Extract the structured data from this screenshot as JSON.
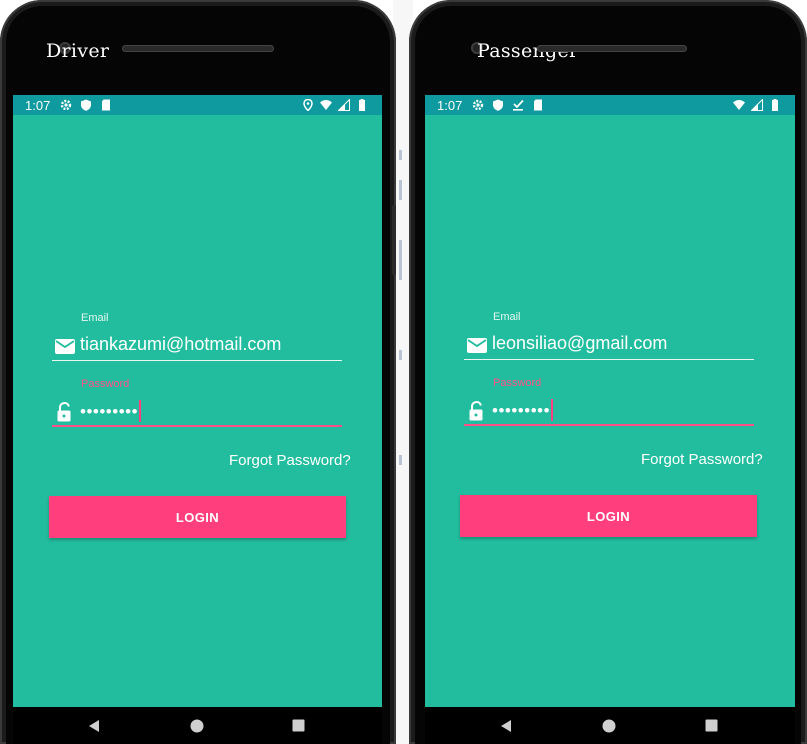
{
  "phones": [
    {
      "title": "Driver",
      "time": "1:07",
      "email_label": "Email",
      "email_value": "tiankazumi@hotmail.com",
      "password_label": "Password",
      "password_value": "•••••••••",
      "forgot": "Forgot Password?",
      "login": "LOGIN"
    },
    {
      "title": "Passenger",
      "time": "1:07",
      "email_label": "Email",
      "email_value": "leonsiliao@gmail.com",
      "password_label": "Password",
      "password_value": "•••••••••",
      "forgot": "Forgot Password?",
      "login": "LOGIN"
    }
  ],
  "colors": {
    "screen_bg": "#22bd9e",
    "status_bar": "#0e9a9e",
    "accent": "#ff3e7e"
  }
}
